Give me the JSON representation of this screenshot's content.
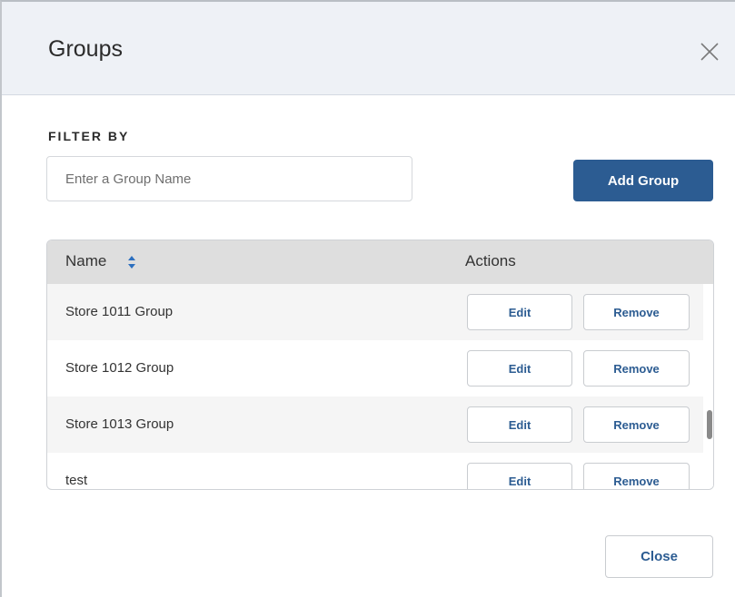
{
  "modal": {
    "title": "Groups"
  },
  "filter": {
    "label": "FILTER BY",
    "placeholder": "Enter a Group Name",
    "value": ""
  },
  "toolbar": {
    "add_group_label": "Add Group"
  },
  "table": {
    "columns": {
      "name": "Name",
      "actions": "Actions"
    },
    "rows": [
      {
        "name": "Store 1011 Group",
        "edit_label": "Edit",
        "remove_label": "Remove"
      },
      {
        "name": "Store 1012 Group",
        "edit_label": "Edit",
        "remove_label": "Remove"
      },
      {
        "name": "Store 1013 Group",
        "edit_label": "Edit",
        "remove_label": "Remove"
      },
      {
        "name": "test",
        "edit_label": "Edit",
        "remove_label": "Remove"
      }
    ]
  },
  "footer": {
    "close_label": "Close"
  },
  "colors": {
    "primary": "#2c5c92",
    "header_bg": "#eef1f6",
    "table_header_bg": "#dedede",
    "sort_icon": "#2c6fbf"
  },
  "icons": {
    "close": "close-icon",
    "sort": "sort-icon"
  }
}
